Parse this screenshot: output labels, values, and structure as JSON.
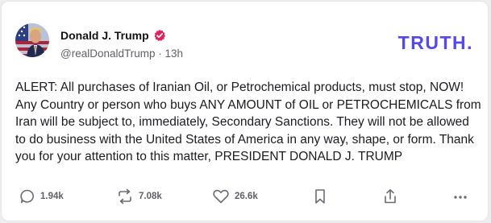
{
  "post": {
    "display_name": "Donald J. Trump",
    "handle": "@realDonaldTrump",
    "separator": "·",
    "time_ago": "13h",
    "text": "ALERT: All purchases of Iranian Oil, or Petrochemical products, must stop, NOW! Any Country or person who buys ANY AMOUNT of OIL or PETROCHEMICALS from Iran will be subject to, immediately, Secondary Sanctions. They will not be allowed to do business with the United States of America in any way, shape, or form. Thank you for your attention to this matter, PRESIDENT DONALD J. TRUMP"
  },
  "brand": {
    "logo_text": "TRUTH",
    "logo_dot": ".",
    "accent_color": "#5448ee",
    "verified_color": "#e0245e"
  },
  "actions": {
    "replies": "1.94k",
    "retruths": "7.08k",
    "likes": "26.6k"
  },
  "icons": [
    "verified-badge-icon",
    "reply-icon",
    "retruth-icon",
    "like-icon",
    "bookmark-icon",
    "share-icon",
    "more-icon"
  ]
}
